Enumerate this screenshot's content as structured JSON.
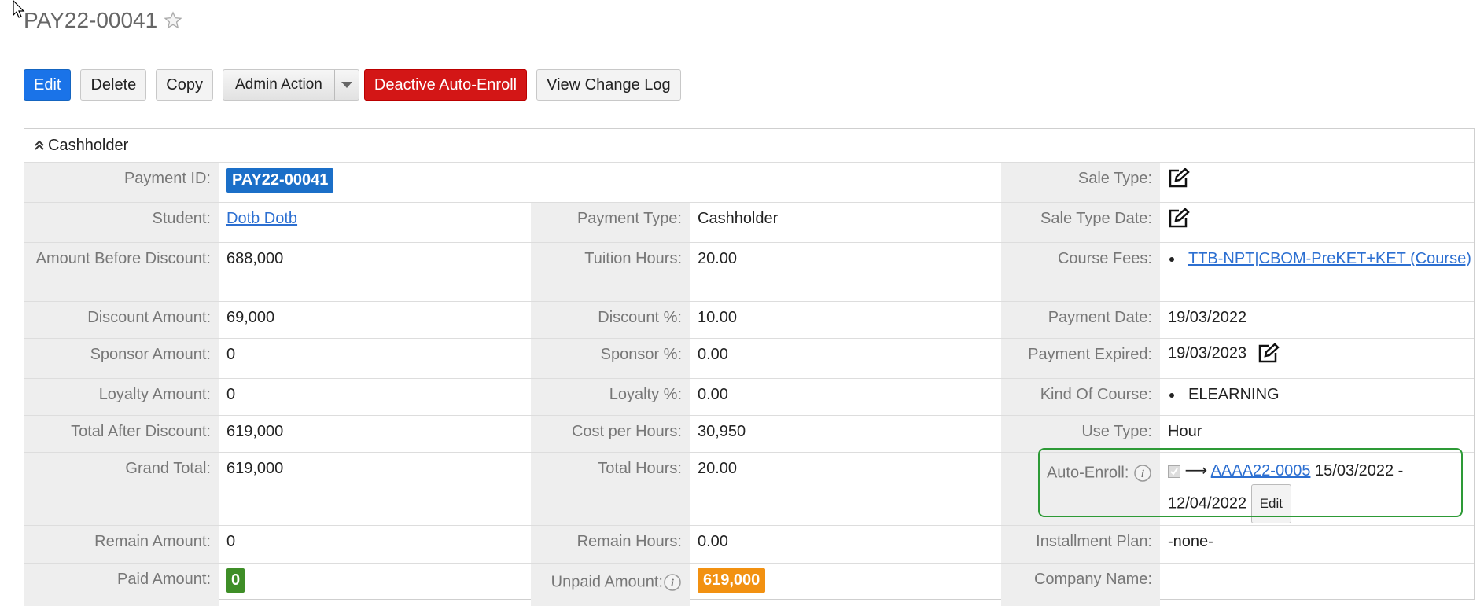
{
  "record": {
    "title": "PAY22-00041"
  },
  "toolbar": {
    "edit": "Edit",
    "delete": "Delete",
    "copy": "Copy",
    "admin_action": "Admin Action",
    "deactive": "Deactive Auto-Enroll",
    "view_log": "View Change Log"
  },
  "colors": {
    "primary": "#1a73e8",
    "danger": "#d31616",
    "success": "#3e8e27",
    "warning": "#f29111",
    "highlight_box": "#2d9a36"
  },
  "panel": {
    "title": "Cashholder",
    "payment_id": {
      "label": "Payment ID:",
      "value": "PAY22-00041"
    },
    "sale_type": {
      "label": "Sale Type:"
    },
    "student": {
      "label": "Student:",
      "value": "Dotb Dotb"
    },
    "payment_type": {
      "label": "Payment Type:",
      "value": "Cashholder"
    },
    "sale_type_date": {
      "label": "Sale Type Date:"
    },
    "amount_before_discount": {
      "label": "Amount Before Discount:",
      "value": "688,000"
    },
    "tuition_hours": {
      "label": "Tuition Hours:",
      "value": "20.00"
    },
    "course_fees": {
      "label": "Course Fees:",
      "value": "TTB-NPT|CBOM-PreKET+KET (Course)"
    },
    "discount_amount": {
      "label": "Discount Amount:",
      "value": "69,000"
    },
    "discount_pct": {
      "label": "Discount %:",
      "value": "10.00"
    },
    "payment_date": {
      "label": "Payment Date:",
      "value": "19/03/2022"
    },
    "sponsor_amount": {
      "label": "Sponsor Amount:",
      "value": "0"
    },
    "sponsor_pct": {
      "label": "Sponsor %:",
      "value": "0.00"
    },
    "payment_expired": {
      "label": "Payment Expired:",
      "value": "19/03/2023"
    },
    "loyalty_amount": {
      "label": "Loyalty Amount:",
      "value": "0"
    },
    "loyalty_pct": {
      "label": "Loyalty %:",
      "value": "0.00"
    },
    "kind_of_course": {
      "label": "Kind Of Course:",
      "value": "ELEARNING"
    },
    "total_after_discount": {
      "label": "Total After Discount:",
      "value": "619,000"
    },
    "cost_per_hours": {
      "label": "Cost per Hours:",
      "value": "30,950"
    },
    "use_type": {
      "label": "Use Type:",
      "value": "Hour"
    },
    "grand_total": {
      "label": "Grand Total:",
      "value": "619,000"
    },
    "total_hours": {
      "label": "Total Hours:",
      "value": "20.00"
    },
    "auto_enroll": {
      "label": "Auto-Enroll:",
      "arrow": "⟶",
      "link": "AAAA22-0005",
      "date_start": "15/03/2022 -",
      "date_end": "12/04/2022",
      "edit": "Edit"
    },
    "remain_amount": {
      "label": "Remain Amount:",
      "value": "0"
    },
    "remain_hours": {
      "label": "Remain Hours:",
      "value": "0.00"
    },
    "installment_plan": {
      "label": "Installment Plan:",
      "value": "-none-"
    },
    "paid_amount": {
      "label": "Paid Amount:",
      "value": "0"
    },
    "unpaid_amount": {
      "label": "Unpaid Amount:",
      "value": "619,000"
    },
    "company_name": {
      "label": "Company Name:",
      "value": ""
    }
  }
}
